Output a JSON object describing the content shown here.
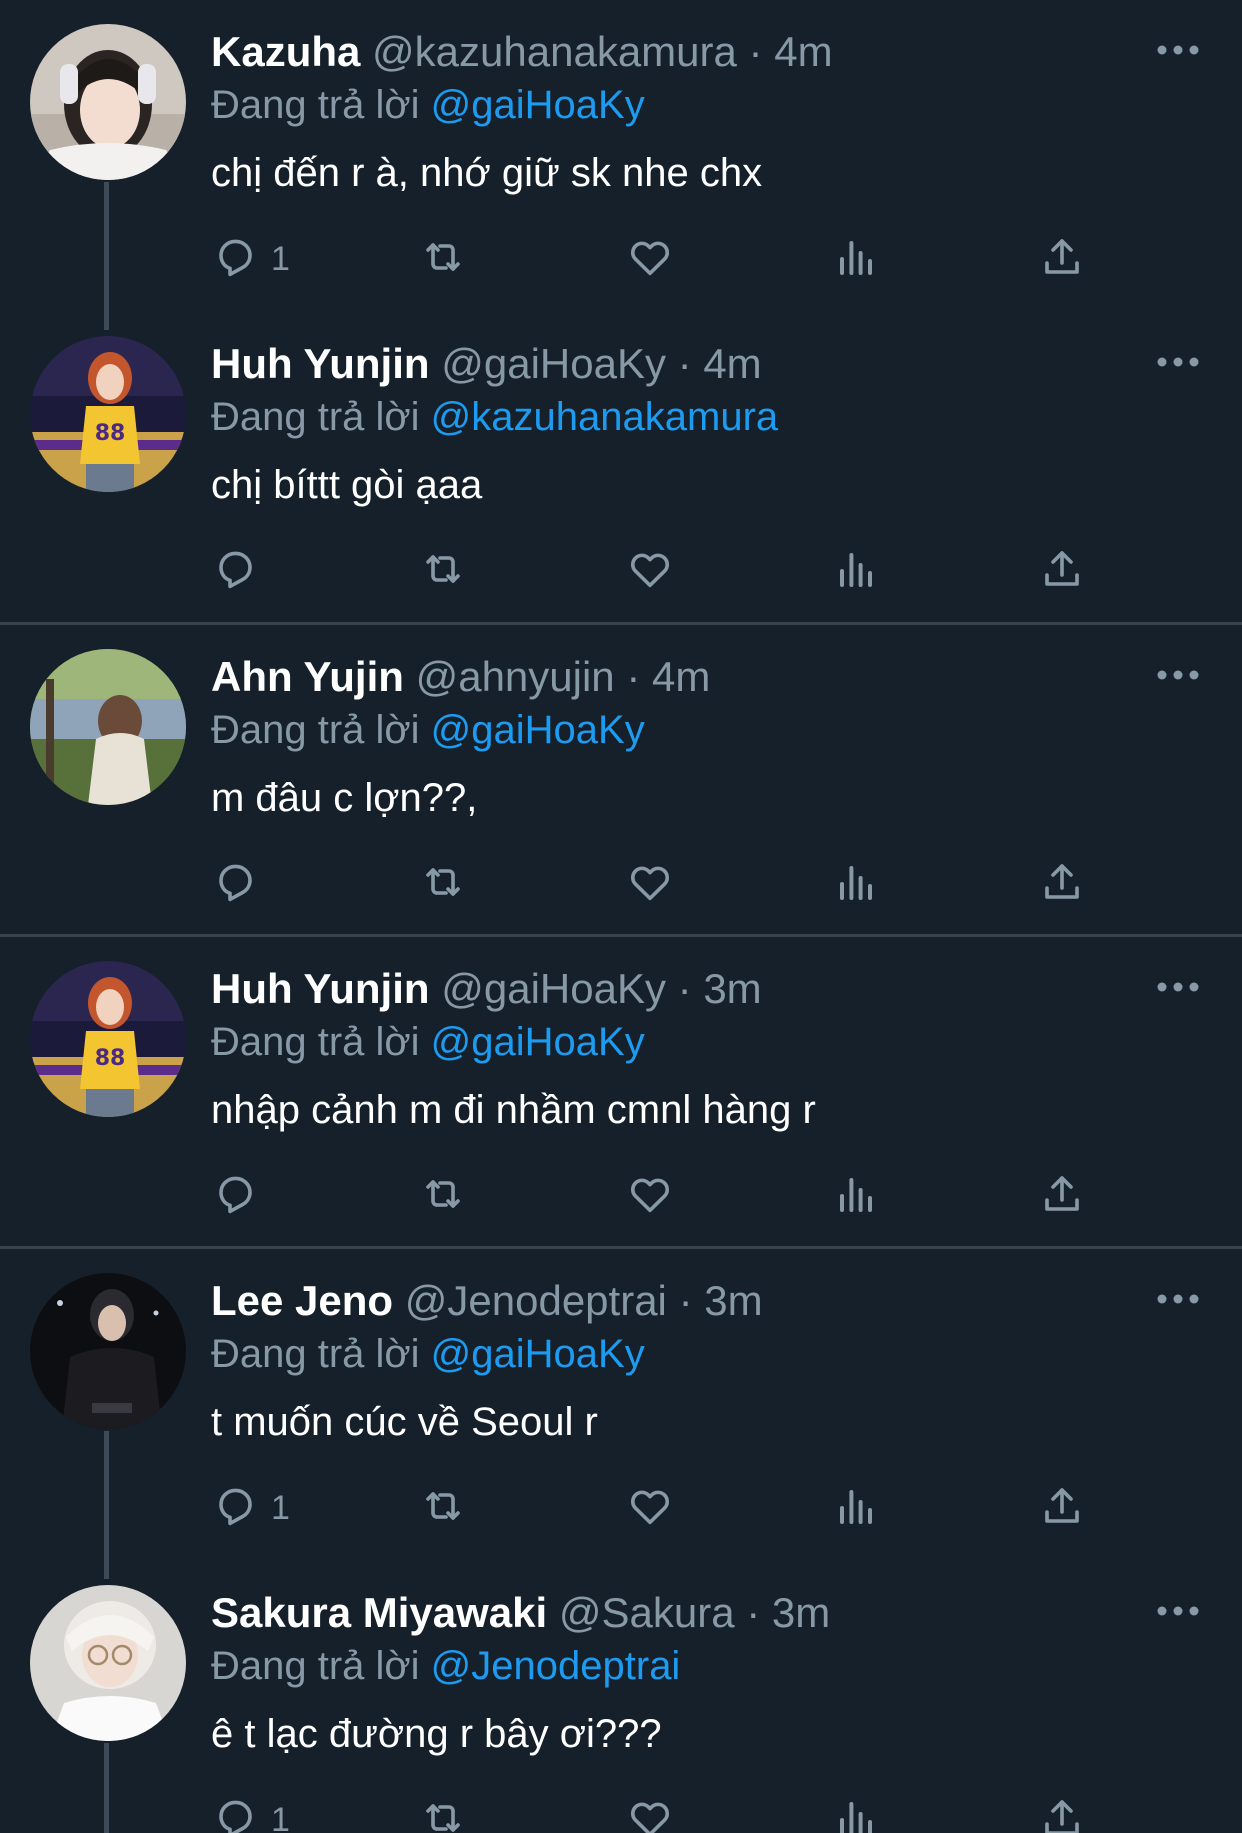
{
  "colors": {
    "background": "#15202b",
    "text": "#ffffff",
    "muted": "#8899a6",
    "mention": "#1d9bf0",
    "divider": "#38444d",
    "thread_line": "#3d4a57"
  },
  "tweets": [
    {
      "name": "Kazuha",
      "handle": "@kazuhanakamura",
      "separator": "·",
      "time": "4m",
      "reply_prefix": "Đang trả lời",
      "reply_to": "@gaiHoaKy",
      "text": "chị đến r à, nhớ giữ sk nhe chx",
      "reply_count": "1",
      "avatar": "avatar-kazuha"
    },
    {
      "name": "Huh Yunjin",
      "handle": "@gaiHoaKy",
      "separator": "·",
      "time": "4m",
      "reply_prefix": "Đang trả lời",
      "reply_to": "@kazuhanakamura",
      "text": "chị bíttt gòi ạaa",
      "reply_count": "",
      "avatar": "avatar-yunjin"
    },
    {
      "name": "Ahn Yujin",
      "handle": "@ahnyujin",
      "separator": "·",
      "time": "4m",
      "reply_prefix": "Đang trả lời",
      "reply_to": "@gaiHoaKy",
      "text": "m đâu c lợn??,",
      "reply_count": "",
      "avatar": "avatar-yujin"
    },
    {
      "name": "Huh Yunjin",
      "handle": "@gaiHoaKy",
      "separator": "·",
      "time": "3m",
      "reply_prefix": "Đang trả lời",
      "reply_to": "@gaiHoaKy",
      "text": "nhập cảnh m đi nhầm cmnl hàng r",
      "reply_count": "",
      "avatar": "avatar-yunjin"
    },
    {
      "name": "Lee Jeno",
      "handle": "@Jenodeptrai",
      "separator": "·",
      "time": "3m",
      "reply_prefix": "Đang trả lời",
      "reply_to": "@gaiHoaKy",
      "text": "t muốn cúc về Seoul r",
      "reply_count": "1",
      "avatar": "avatar-jeno"
    },
    {
      "name": "Sakura Miyawaki",
      "handle": "@Sakura",
      "separator": "·",
      "time": "3m",
      "reply_prefix": "Đang trả lời",
      "reply_to": "@Jenodeptrai",
      "text": "ê t lạc đường r bây ơi???",
      "reply_count": "1",
      "avatar": "avatar-sakura"
    }
  ],
  "icons": [
    "reply-icon",
    "retweet-icon",
    "like-icon",
    "analytics-icon",
    "share-icon",
    "more-icon"
  ]
}
